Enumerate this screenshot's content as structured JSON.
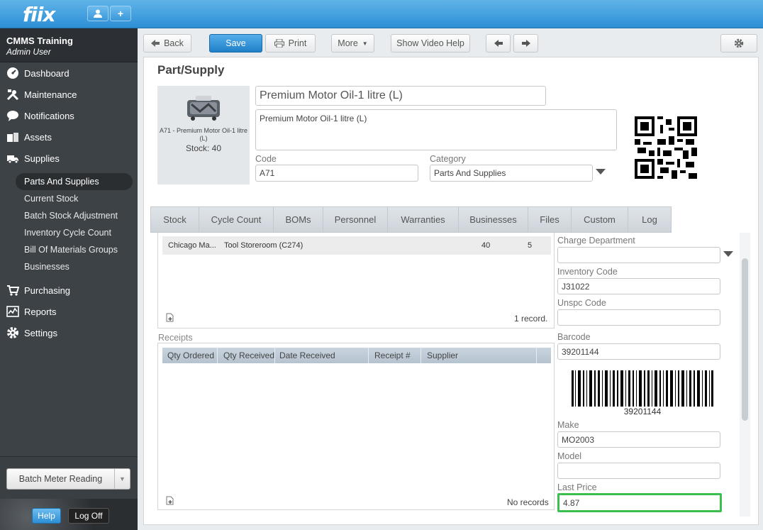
{
  "app": {
    "logo": "fiix"
  },
  "org": {
    "name": "CMMS Training",
    "user": "Admin User"
  },
  "nav": {
    "items": [
      {
        "label": "Dashboard",
        "icon": "dashboard-icon"
      },
      {
        "label": "Maintenance",
        "icon": "tools-icon"
      },
      {
        "label": "Notifications",
        "icon": "chat-bubble-icon"
      },
      {
        "label": "Assets",
        "icon": "boxes-icon"
      },
      {
        "label": "Supplies",
        "icon": "truck-icon"
      }
    ],
    "sub_items": [
      "Parts And Supplies",
      "Current Stock",
      "Batch Stock Adjustment",
      "Inventory Cycle Count",
      "Bill Of Materials Groups",
      "Businesses"
    ],
    "lower_items": [
      {
        "label": "Purchasing",
        "icon": "cart-icon"
      },
      {
        "label": "Reports",
        "icon": "chart-icon"
      },
      {
        "label": "Settings",
        "icon": "gear-icon"
      }
    ]
  },
  "batch_meter": "Batch Meter Reading",
  "footer": {
    "help": "Help",
    "logoff": "Log Off"
  },
  "toolbar": {
    "back": "Back",
    "save": "Save",
    "print": "Print",
    "more": "More",
    "video": "Show Video Help"
  },
  "page": {
    "title": "Part/Supply",
    "thumb_caption": "A71 - Premium Motor Oil-1 litre (L)",
    "thumb_stock": "Stock: 40",
    "name": "Premium Motor Oil-1 litre (L)",
    "description": "Premium Motor Oil-1 litre (L)",
    "code_label": "Code",
    "code": "A71",
    "category_label": "Category",
    "category": "Parts And Supplies"
  },
  "tabs": [
    "Stock",
    "Cycle Count",
    "BOMs",
    "Personnel",
    "Warranties",
    "Businesses",
    "Files",
    "Custom",
    "Log"
  ],
  "stock_row": {
    "facility": "Chicago Ma...",
    "location": "Tool Storeroom (C274)",
    "qty": "40",
    "min": "5"
  },
  "stock_records": "1 record.",
  "receipts": {
    "title": "Receipts",
    "columns": [
      "Qty Ordered",
      "Qty Received",
      "Date Received",
      "Receipt #",
      "Supplier"
    ],
    "empty": "No records"
  },
  "right": {
    "charge_dept_label": "Charge Department",
    "charge_dept": "",
    "inventory_code_label": "Inventory Code",
    "inventory_code": "J31022",
    "unspc_label": "Unspc Code",
    "unspc": "",
    "barcode_label": "Barcode",
    "barcode": "39201144",
    "barcode_text": "39201144",
    "make_label": "Make",
    "make": "MO2003",
    "model_label": "Model",
    "model": "",
    "last_price_label": "Last Price",
    "last_price": "4.87"
  }
}
